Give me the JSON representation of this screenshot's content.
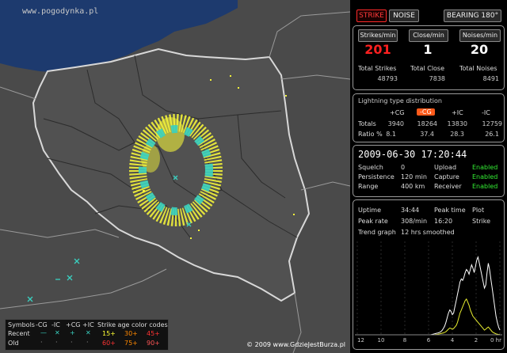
{
  "watermark": "www.pogodynka.pl",
  "map_copyright": "© 2009 www.GdzieJestBurza.pl",
  "legend": {
    "symbols_label": "Symbols",
    "col_neg_cg": "-CG",
    "col_neg_ic": "-IC",
    "col_pos_cg": "+CG",
    "col_pos_ic": "+IC",
    "recent_label": "Recent",
    "old_label": "Old",
    "age_title": "Strike age color codes",
    "recent_ages": [
      "15+",
      "30+",
      "45+"
    ],
    "old_ages": [
      "60+",
      "75+",
      "90+"
    ],
    "recent_colors": [
      "#ffff33",
      "#ff8800",
      "#ff3333"
    ],
    "old_colors": [
      "#ff3333",
      "#ff8800",
      "#ff5555"
    ]
  },
  "toolbar": {
    "strike": "STRIKE",
    "noise": "NOISE",
    "bearing": "BEARING 180°"
  },
  "counters": {
    "strikes_per_min_label": "Strikes/min",
    "close_per_min_label": "Close/min",
    "noises_per_min_label": "Noises/min",
    "strikes_per_min": "201",
    "close_per_min": "1",
    "noises_per_min": "20",
    "total_strikes_label": "Total Strikes",
    "total_close_label": "Total Close",
    "total_noises_label": "Total Noises",
    "total_strikes": "48793",
    "total_close": "7838",
    "total_noises": "8491"
  },
  "distribution": {
    "title": "Lightning type distribution",
    "headers": [
      "+CG",
      "-CG",
      "+IC",
      "-IC"
    ],
    "totals_label": "Totals",
    "totals": [
      "3940",
      "18264",
      "13830",
      "12759"
    ],
    "ratio_label": "Ratio %",
    "ratios": [
      "8.1",
      "37.4",
      "28.3",
      "26.1"
    ]
  },
  "status": {
    "datetime": "2009-06-30 17:20:44",
    "squelch_label": "Squelch",
    "squelch": "0",
    "upload_label": "Upload",
    "upload": "Enabled",
    "persistence_label": "Persistence",
    "persistence": "120 min",
    "capture_label": "Capture",
    "capture": "Enabled",
    "range_label": "Range",
    "range": "400 km",
    "receiver_label": "Receiver",
    "receiver": "Enabled"
  },
  "stats": {
    "uptime_label": "Uptime",
    "uptime": "34:44",
    "peak_time_label": "Peak time",
    "plot_label": "Plot",
    "peak_rate_label": "Peak rate",
    "peak_rate": "308/min",
    "peak_time": "16:20",
    "plot": "Strike",
    "trend_label": "Trend graph",
    "trend": "12 hrs smoothed"
  },
  "trend_chart": {
    "x_ticks": [
      "12",
      "10",
      "8",
      "6",
      "4",
      "2",
      "0 hr"
    ],
    "white": [
      0,
      0,
      0,
      0,
      0,
      0,
      0,
      0,
      0,
      0,
      0,
      0,
      0,
      0,
      0,
      0,
      0,
      0,
      0,
      0,
      0,
      0,
      0,
      0,
      0,
      0,
      0,
      0,
      0,
      0,
      0,
      0,
      0,
      0,
      0,
      0,
      0,
      0,
      0,
      0,
      0,
      0,
      0,
      0,
      0,
      0,
      0,
      0,
      0,
      0,
      0,
      0,
      0,
      0,
      0,
      0,
      0,
      0,
      1,
      2,
      3,
      4,
      5,
      6,
      8,
      10,
      14,
      20,
      28,
      40,
      55,
      70,
      80,
      75,
      65,
      70,
      90,
      110,
      130,
      150,
      170,
      180,
      175,
      185,
      200,
      210,
      205,
      195,
      210,
      225,
      215,
      200,
      220,
      240,
      250,
      230,
      210,
      190,
      170,
      150,
      160,
      200,
      230,
      210,
      180,
      150,
      120,
      90,
      60,
      40,
      25,
      15
    ],
    "yellow": [
      0,
      0,
      0,
      0,
      0,
      0,
      0,
      0,
      0,
      0,
      0,
      0,
      0,
      0,
      0,
      0,
      0,
      0,
      0,
      0,
      0,
      0,
      0,
      0,
      0,
      0,
      0,
      0,
      0,
      0,
      0,
      0,
      0,
      0,
      0,
      0,
      0,
      0,
      0,
      0,
      0,
      0,
      0,
      0,
      0,
      0,
      0,
      0,
      0,
      0,
      0,
      0,
      0,
      0,
      0,
      0,
      0,
      0,
      0,
      0,
      0,
      1,
      1,
      2,
      3,
      4,
      5,
      6,
      8,
      10,
      14,
      18,
      22,
      20,
      18,
      20,
      25,
      30,
      40,
      55,
      70,
      80,
      90,
      100,
      110,
      115,
      105,
      95,
      80,
      70,
      60,
      55,
      50,
      45,
      40,
      35,
      30,
      25,
      20,
      15,
      18,
      22,
      25,
      20,
      15,
      10,
      7,
      5,
      3,
      2,
      1,
      1
    ],
    "ymax": 280
  }
}
